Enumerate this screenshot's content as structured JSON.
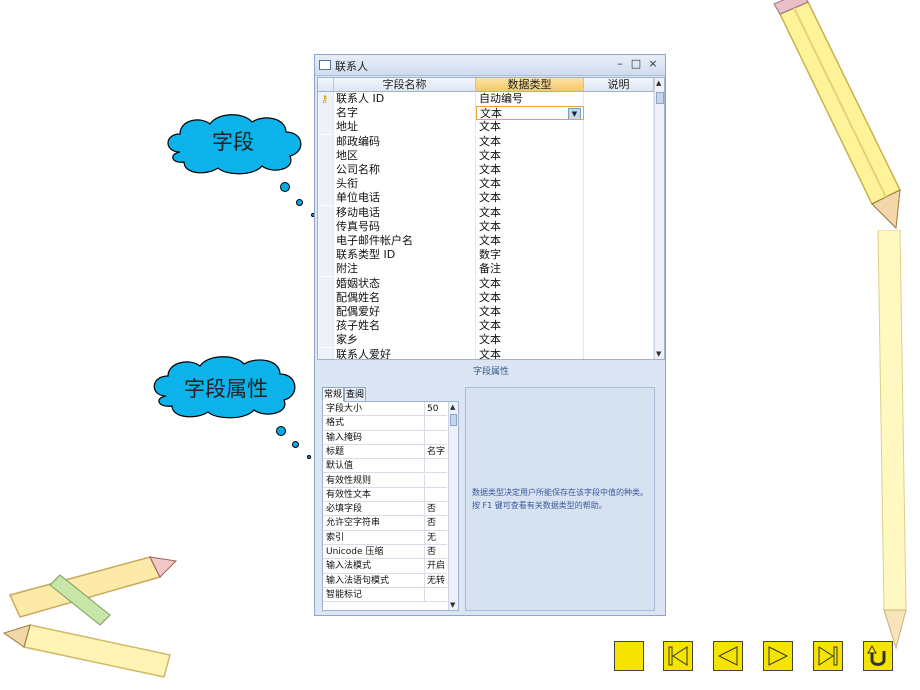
{
  "window": {
    "title": "联系人",
    "controls": {
      "minimize": "–",
      "maximize": "□",
      "close": "×"
    }
  },
  "grid": {
    "headers": {
      "field_name": "字段名称",
      "data_type": "数据类型",
      "description": "说明"
    },
    "rows": [
      {
        "name": "联系人 ID",
        "type": "自动编号",
        "key": true
      },
      {
        "name": "名字",
        "type": "文本",
        "selected": true
      },
      {
        "name": "地址",
        "type": "文本"
      },
      {
        "name": "邮政编码",
        "type": "文本"
      },
      {
        "name": "地区",
        "type": "文本"
      },
      {
        "name": "公司名称",
        "type": "文本"
      },
      {
        "name": "头衔",
        "type": "文本"
      },
      {
        "name": "单位电话",
        "type": "文本"
      },
      {
        "name": "移动电话",
        "type": "文本"
      },
      {
        "name": "传真号码",
        "type": "文本"
      },
      {
        "name": "电子邮件帐户名",
        "type": "文本"
      },
      {
        "name": "联系类型 ID",
        "type": "数字"
      },
      {
        "name": "附注",
        "type": "备注"
      },
      {
        "name": "婚姻状态",
        "type": "文本"
      },
      {
        "name": "配偶姓名",
        "type": "文本"
      },
      {
        "name": "配偶爱好",
        "type": "文本"
      },
      {
        "name": "孩子姓名",
        "type": "文本"
      },
      {
        "name": "家乡",
        "type": "文本"
      },
      {
        "name": "联系人爱好",
        "type": "文本"
      }
    ]
  },
  "properties": {
    "section_title": "字段属性",
    "tabs": [
      "常规",
      "查阅"
    ],
    "rows": [
      {
        "name": "字段大小",
        "value": "50"
      },
      {
        "name": "格式",
        "value": ""
      },
      {
        "name": "输入掩码",
        "value": ""
      },
      {
        "name": "标题",
        "value": "名字"
      },
      {
        "name": "默认值",
        "value": ""
      },
      {
        "name": "有效性规则",
        "value": ""
      },
      {
        "name": "有效性文本",
        "value": ""
      },
      {
        "name": "必填字段",
        "value": "否"
      },
      {
        "name": "允许空字符串",
        "value": "否"
      },
      {
        "name": "索引",
        "value": "无"
      },
      {
        "name": "Unicode 压缩",
        "value": "否"
      },
      {
        "name": "输入法模式",
        "value": "开启"
      },
      {
        "name": "输入法语句模式",
        "value": "无转"
      },
      {
        "name": "智能标记",
        "value": ""
      }
    ],
    "help_text": "数据类型决定用户所能保存在该字段中值的种类。按 F1 键可查看有关数据类型的帮助。"
  },
  "callouts": {
    "field": "字段",
    "field_properties": "字段属性"
  },
  "nav_buttons": [
    "home-button",
    "first-button",
    "prev-button",
    "next-button",
    "last-button",
    "return-button"
  ]
}
